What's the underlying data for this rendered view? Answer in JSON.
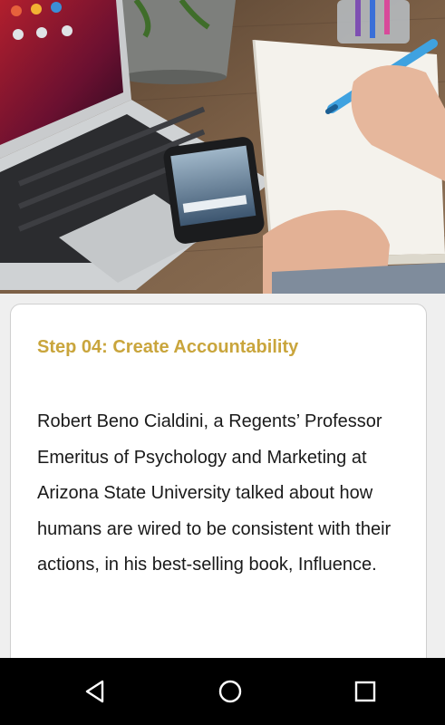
{
  "article": {
    "step_title": "Step 04: Create Accountability",
    "body": "Robert Beno Cialdini, a Regents’ Professor Emeritus of Psychology and Marketing at Arizona State University talked about how humans are wired to be consistent with their actions, in his best-selling book, Influence."
  },
  "hero_image": {
    "icons": [
      "laptop",
      "smartphone",
      "notebook",
      "pen",
      "plant-pot",
      "pencil-cup"
    ]
  },
  "navbar": {
    "icons": [
      "back-icon",
      "home-icon",
      "recents-icon"
    ]
  },
  "colors": {
    "title_accent": "#c9a53c",
    "body_text": "#1a1a1a",
    "card_bg": "#ffffff",
    "nav_bg": "#000000"
  }
}
